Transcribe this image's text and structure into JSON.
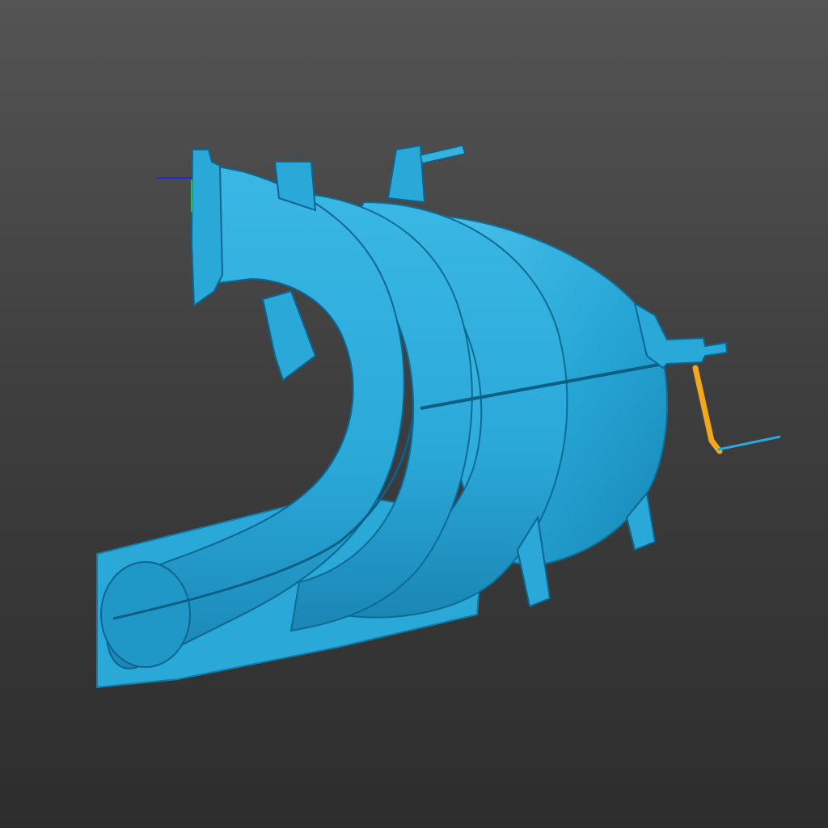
{
  "viewport": {
    "background_top": "#545454",
    "background_bottom": "#2d2d2d"
  },
  "model": {
    "kind": "3d-mesh",
    "subject": "intake-manifold-scan",
    "mesh_color": "#2aa8d8",
    "mesh_shadow_color": "#116f96",
    "mesh_highlight_color": "#5cc8ef",
    "selection_color": "#f2a81d"
  },
  "axes_gizmo": {
    "x_color": "#1f2bd6",
    "y_color": "#2fbf3a"
  }
}
